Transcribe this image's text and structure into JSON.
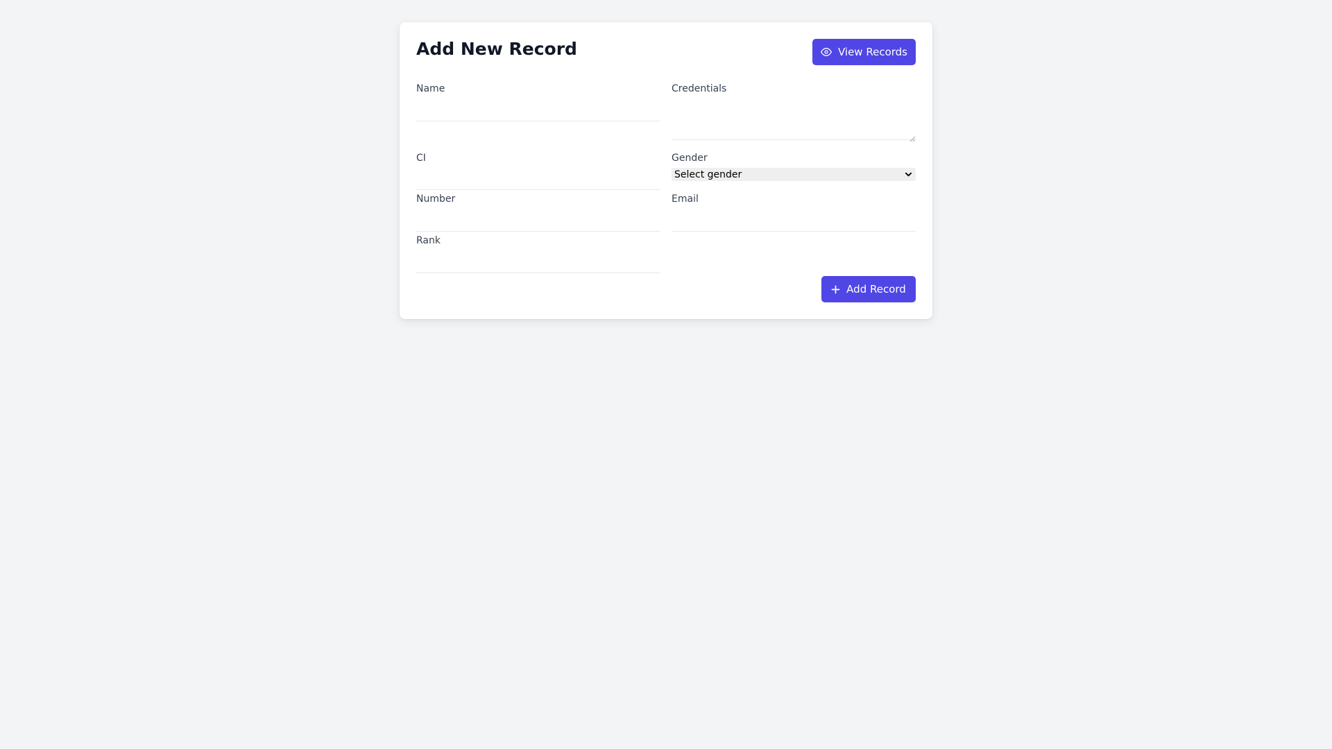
{
  "form": {
    "title": "Add New Record",
    "view_records_label": "View Records",
    "add_record_label": "Add Record",
    "fields": {
      "name": {
        "label": "Name",
        "value": ""
      },
      "credentials": {
        "label": "Credentials",
        "value": ""
      },
      "ci": {
        "label": "CI",
        "value": ""
      },
      "gender": {
        "label": "Gender",
        "selected": "Select gender"
      },
      "number": {
        "label": "Number",
        "value": ""
      },
      "email": {
        "label": "Email",
        "value": ""
      },
      "rank": {
        "label": "Rank",
        "value": ""
      }
    }
  },
  "icons": {
    "view": "eye-icon",
    "add": "plus-icon",
    "select": "chevron-down-icon"
  },
  "colors": {
    "accent": "#4f46e5",
    "background": "#f3f4f6",
    "card": "#ffffff",
    "title": "#111827",
    "label": "#374151"
  }
}
